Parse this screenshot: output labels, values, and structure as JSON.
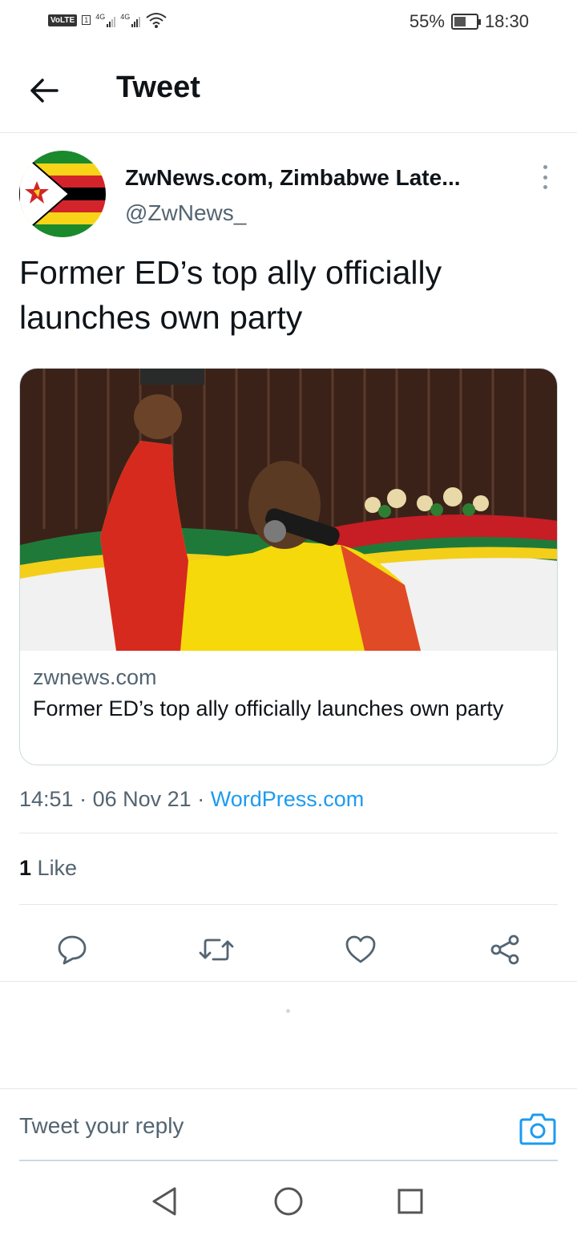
{
  "status_bar": {
    "volte": "VoLTE",
    "sim": "1",
    "net1": "4G",
    "net2": "4G",
    "battery_percent": "55%",
    "battery_level": 0.55,
    "time": "18:30"
  },
  "header": {
    "title": "Tweet",
    "back_icon": "arrow-left-icon"
  },
  "tweet": {
    "author_name": "ZwNews.com, Zimbabwe Late...",
    "author_handle": "@ZwNews_",
    "text": "Former ED’s top ally officially launches own party",
    "card": {
      "domain": "zwnews.com",
      "title": "Former ED’s top ally officially launches own party"
    },
    "time": "14:51",
    "date": "06 Nov 21",
    "source": "WordPress.com",
    "likes_count": "1",
    "likes_label": "Like"
  },
  "actions": {
    "reply_icon": "reply-icon",
    "retweet_icon": "retweet-icon",
    "like_icon": "heart-icon",
    "share_icon": "share-icon"
  },
  "reply": {
    "placeholder": "Tweet your reply",
    "camera_icon": "camera-icon"
  },
  "colors": {
    "accent": "#1d9bf0",
    "text_primary": "#0f1419",
    "text_secondary": "#536471",
    "divider": "#e6e6e6"
  }
}
